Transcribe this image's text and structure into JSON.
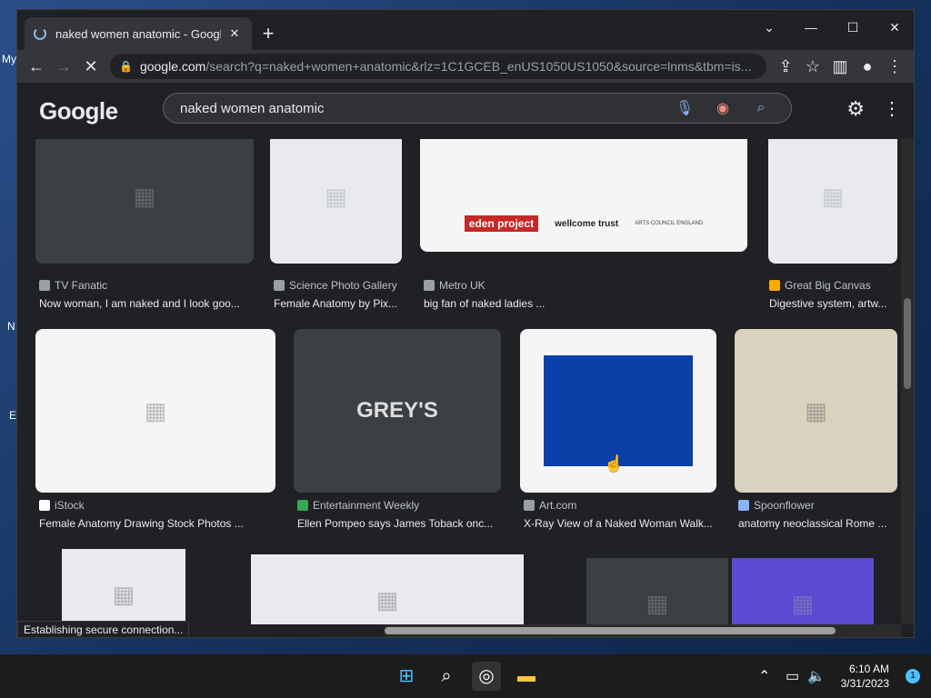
{
  "desktop": {
    "labels": [
      "My",
      "N",
      "E"
    ]
  },
  "browser": {
    "tab_title": "naked women anatomic - Google",
    "url_host": "google.com",
    "url_path": "/search?q=naked+women+anatomic&rlz=1C1GCEB_enUS1050US1050&source=lnms&tbm=is...",
    "status_text": "Establishing secure connection..."
  },
  "google": {
    "logo": "Google",
    "query": "naked women anatomic"
  },
  "results": [
    {
      "source": "TV Fanatic",
      "caption": "Now woman, I am naked and I look goo..."
    },
    {
      "source": "Science Photo Gallery",
      "caption": "Female Anatomy by Pix..."
    },
    {
      "source": "Metro UK",
      "caption": "big fan of naked ladies ..."
    },
    {
      "source": "Great Big Canvas",
      "caption": "Digestive system, artw..."
    },
    {
      "source": "iStock",
      "caption": "Female Anatomy Drawing Stock Photos ..."
    },
    {
      "source": "Entertainment Weekly",
      "caption": "Ellen Pompeo says James Toback onc..."
    },
    {
      "source": "Art.com",
      "caption": "X-Ray View of a Naked Woman Walk..."
    },
    {
      "source": "Spoonflower",
      "caption": "anatomy neoclassical Rome ..."
    }
  ],
  "image_text": {
    "eden": "eden project",
    "wellcome": "wellcome trust",
    "arts": "ARTS COUNCIL ENGLAND",
    "greys": "GREY'S"
  },
  "taskbar": {
    "time": "6:10 AM",
    "date": "3/31/2023",
    "notifications": "1"
  }
}
